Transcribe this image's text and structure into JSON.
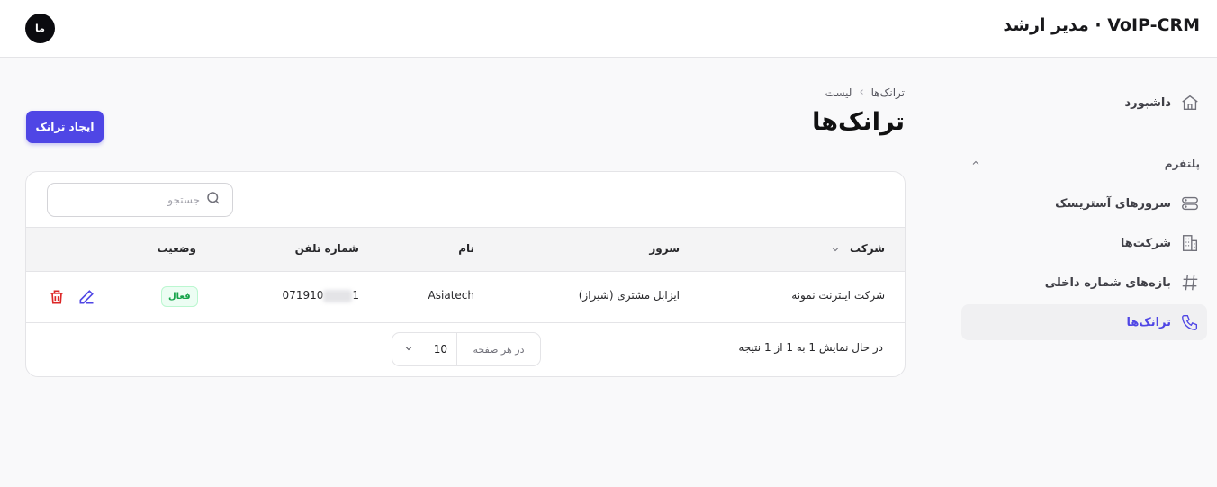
{
  "header": {
    "brand": "VoIP-CRM · مدیر ارشد",
    "avatar_initials": "ما"
  },
  "sidebar": {
    "dashboard": {
      "label": "داشبورد",
      "icon": "home-icon"
    },
    "section": {
      "label": "پلتفرم",
      "icon": "chevron-up-icon"
    },
    "items": [
      {
        "label": "سرورهای آستریسک",
        "icon": "server-icon"
      },
      {
        "label": "شرکت‌ها",
        "icon": "building-icon"
      },
      {
        "label": "بازه‌های شماره داخلی",
        "icon": "hash-icon"
      },
      {
        "label": "ترانک‌ها",
        "icon": "phone-icon",
        "active": true
      }
    ]
  },
  "breadcrumb": {
    "parent": "ترانک‌ها",
    "separator": "›",
    "current": "لیست"
  },
  "page": {
    "title": "ترانک‌ها",
    "create_button": "ایجاد ترانک"
  },
  "search": {
    "placeholder": "جستجو",
    "value": ""
  },
  "table": {
    "columns": {
      "company": "شرکت",
      "server": "سرور",
      "name": "نام",
      "phone": "شماره تلفن",
      "status": "وضعیت"
    },
    "rows": [
      {
        "company": "شرکت اینترنت نمونه",
        "server": "ایزابل مشتری (شیراز)",
        "name": "Asiatech",
        "phone_prefix": "071910",
        "phone_suffix": "1",
        "status": "فعال"
      }
    ]
  },
  "pagination": {
    "summary": "در حال نمایش 1 به 1 از 1 نتیجه",
    "per_page_label": "در هر صفحه",
    "per_page_value": "10"
  },
  "colors": {
    "accent": "#4f46e5",
    "status_active": "#16a34a",
    "delete": "#dc2626"
  }
}
